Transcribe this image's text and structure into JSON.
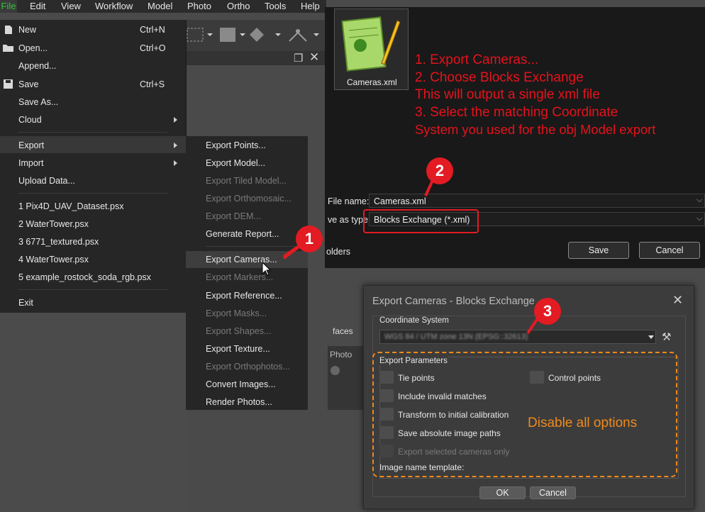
{
  "menubar": {
    "items": [
      "File",
      "Edit",
      "View",
      "Workflow",
      "Model",
      "Photo",
      "Ortho",
      "Tools",
      "Help"
    ]
  },
  "file_menu": {
    "new": "New",
    "new_sc": "Ctrl+N",
    "open": "Open...",
    "open_sc": "Ctrl+O",
    "append": "Append...",
    "save": "Save",
    "save_sc": "Ctrl+S",
    "save_as": "Save As...",
    "cloud": "Cloud",
    "export": "Export",
    "import": "Import",
    "upload": "Upload Data...",
    "recent": [
      "1 Pix4D_UAV_Dataset.psx",
      "2 WaterTower.psx",
      "3 6771_textured.psx",
      "4 WaterTower.psx",
      "5 example_rostock_soda_rgb.psx"
    ],
    "exit": "Exit"
  },
  "export_menu": {
    "points": "Export Points...",
    "model": "Export Model...",
    "tiled": "Export Tiled Model...",
    "ortho": "Export Orthomosaic...",
    "dem": "Export DEM...",
    "report": "Generate Report...",
    "cameras": "Export Cameras...",
    "markers": "Export Markers...",
    "reference": "Export Reference...",
    "masks": "Export Masks...",
    "shapes": "Export Shapes...",
    "texture": "Export Texture...",
    "orthophotos": "Export Orthophotos...",
    "convert": "Convert Images...",
    "render": "Render Photos..."
  },
  "save_dialog": {
    "file_icon_label": "Cameras.xml",
    "file_name_label": "File name:",
    "file_name_value": "Cameras.xml",
    "save_type_label": "ve as type:",
    "save_type_value": "Blocks Exchange (*.xml)",
    "folders_label": "olders",
    "save_button": "Save",
    "cancel_button": "Cancel",
    "faces_label": "faces",
    "photos_label": "Photo"
  },
  "annotation": {
    "lines": [
      "1. Export Cameras...",
      "2. Choose Blocks Exchange",
      "This will output a single xml file",
      "3. Select the matching Coordinate",
      "System you used for the obj Model export"
    ],
    "badge1": "1",
    "badge2": "2",
    "badge3": "3",
    "disable_note": "Disable all options",
    "red": "#e31b23",
    "orange": "#f08a1c"
  },
  "export_dialog": {
    "title": "Export Cameras - Blocks Exchange",
    "coord_label": "Coordinate System",
    "coord_value": "WGS 84 / UTM zone 13N (EPSG::32613)",
    "params_label": "Export Parameters",
    "tie_points": "Tie points",
    "control_points": "Control points",
    "invalid_matches": "Include invalid matches",
    "transform": "Transform to initial calibration",
    "abs_paths": "Save absolute image paths",
    "selected_only": "Export selected cameras only",
    "name_template": "Image name template:",
    "ok": "OK",
    "cancel": "Cancel"
  }
}
